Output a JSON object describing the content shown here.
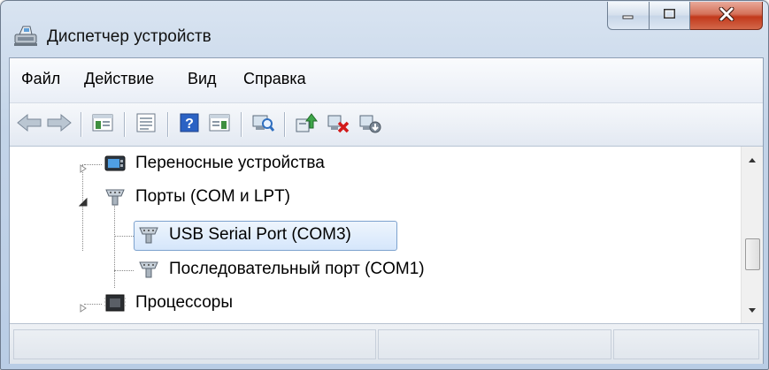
{
  "window": {
    "title": "Диспетчер устройств",
    "app_icon": "device-manager-icon",
    "caption_buttons": [
      "minimize-icon",
      "maximize-icon",
      "close-icon"
    ]
  },
  "menu": {
    "items": [
      "Файл",
      "Действие",
      "Вид",
      "Справка"
    ]
  },
  "toolbar": {
    "icons": [
      "back-arrow-icon",
      "forward-arrow-icon",
      "show-hide-console-tree-icon",
      "properties-icon",
      "help-icon",
      "action-pane-icon",
      "scan-hardware-icon",
      "update-driver-icon",
      "uninstall-device-icon",
      "disable-device-icon"
    ]
  },
  "tree": {
    "nodes": [
      {
        "label": "Переносные устройства",
        "icon": "portable-device-icon",
        "expander": "collapsed",
        "level": 0
      },
      {
        "label": "Порты (COM и LPT)",
        "icon": "port-icon",
        "expander": "expanded",
        "level": 0
      },
      {
        "label": "USB Serial Port (COM3)",
        "icon": "port-icon",
        "expander": "none",
        "level": 1,
        "selected": true
      },
      {
        "label": "Последовательный порт (COM1)",
        "icon": "port-icon",
        "expander": "none",
        "level": 1
      },
      {
        "label": "Процессоры",
        "icon": "processor-icon",
        "expander": "collapsed",
        "level": 0
      }
    ]
  },
  "colors": {
    "selection_border": "#7da2ce",
    "selection_fill": "#d5e6fb",
    "close_button": "#c2391c",
    "title_bar": "#c3d4e8"
  }
}
